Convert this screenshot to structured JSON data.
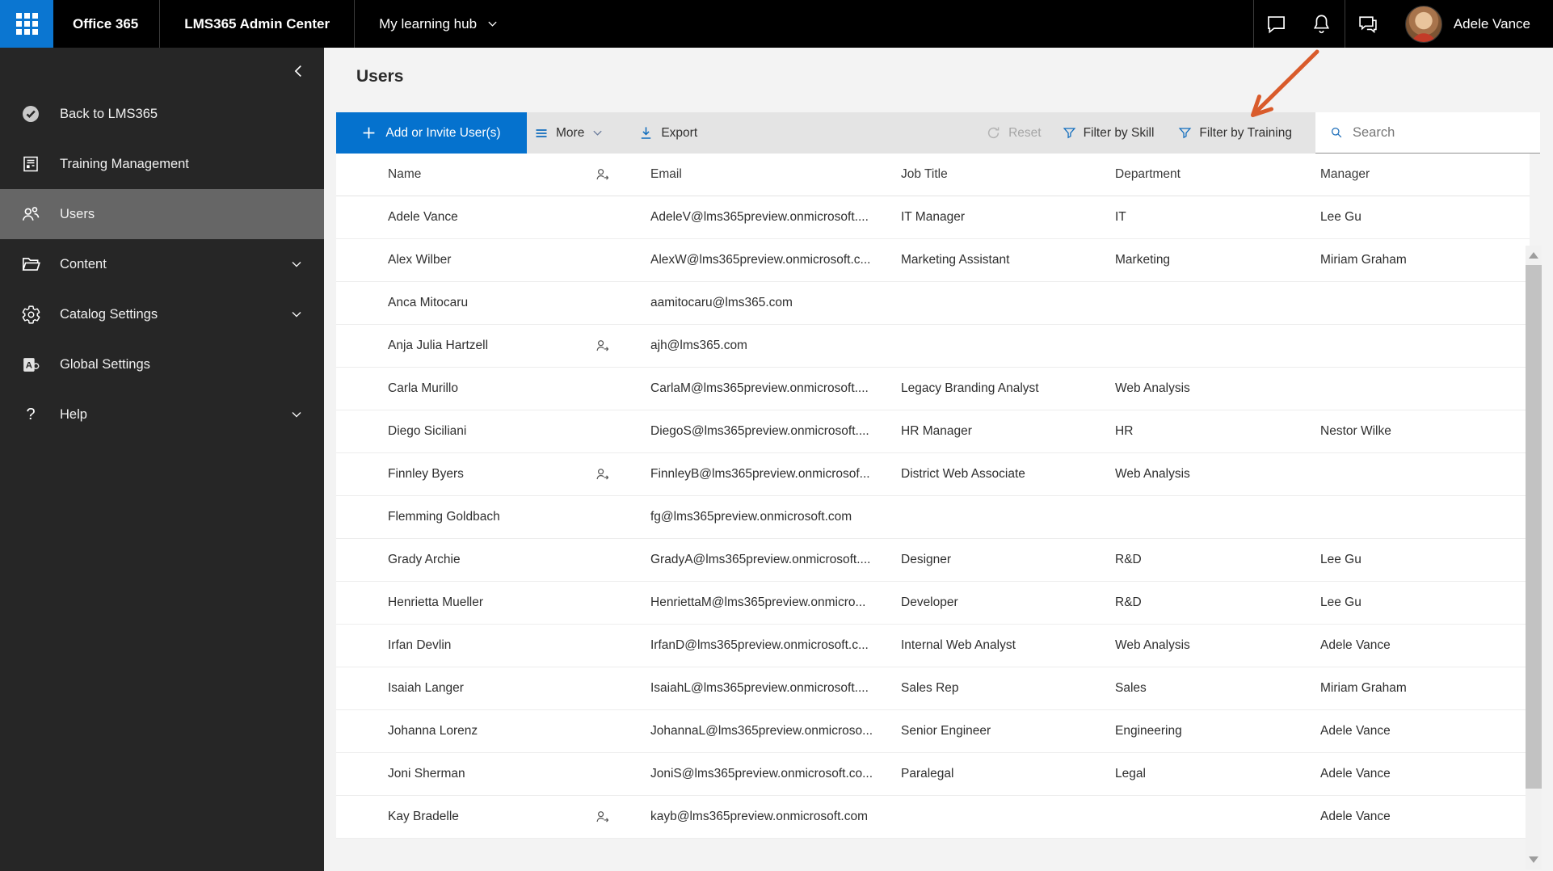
{
  "topbar": {
    "brand": "Office 365",
    "admin_center": "LMS365 Admin Center",
    "learning_hub": "My learning hub",
    "user_name": "Adele Vance"
  },
  "sidebar": {
    "items": [
      {
        "label": "Back to LMS365",
        "icon": "lms365-logo-icon",
        "chevron": false,
        "selected": false
      },
      {
        "label": "Training Management",
        "icon": "training-document-icon",
        "chevron": false,
        "selected": false
      },
      {
        "label": "Users",
        "icon": "people-icon",
        "chevron": false,
        "selected": true
      },
      {
        "label": "Content",
        "icon": "folder-icon",
        "chevron": true,
        "selected": false
      },
      {
        "label": "Catalog Settings",
        "icon": "gear-icon",
        "chevron": true,
        "selected": false
      },
      {
        "label": "Global Settings",
        "icon": "admin-app-icon",
        "chevron": false,
        "selected": false
      },
      {
        "label": "Help",
        "icon": "question-icon",
        "chevron": true,
        "selected": false
      }
    ]
  },
  "page": {
    "title": "Users"
  },
  "toolbar": {
    "add_button": "Add or Invite User(s)",
    "more": "More",
    "export": "Export",
    "reset": "Reset",
    "filter_skill": "Filter by Skill",
    "filter_training": "Filter by Training",
    "search_placeholder": "Search"
  },
  "table": {
    "headers": [
      "Name",
      "Email",
      "Job Title",
      "Department",
      "Manager"
    ],
    "rows": [
      {
        "name": "Adele Vance",
        "invited": false,
        "email": "AdeleV@lms365preview.onmicrosoft....",
        "job_title": "IT Manager",
        "department": "IT",
        "manager": "Lee Gu"
      },
      {
        "name": "Alex Wilber",
        "invited": false,
        "email": "AlexW@lms365preview.onmicrosoft.c...",
        "job_title": "Marketing Assistant",
        "department": "Marketing",
        "manager": "Miriam Graham"
      },
      {
        "name": "Anca Mitocaru",
        "invited": false,
        "email": "aamitocaru@lms365.com",
        "job_title": "",
        "department": "",
        "manager": ""
      },
      {
        "name": "Anja Julia Hartzell",
        "invited": true,
        "email": "ajh@lms365.com",
        "job_title": "",
        "department": "",
        "manager": ""
      },
      {
        "name": "Carla Murillo",
        "invited": false,
        "email": "CarlaM@lms365preview.onmicrosoft....",
        "job_title": "Legacy Branding Analyst",
        "department": "Web Analysis",
        "manager": ""
      },
      {
        "name": "Diego Siciliani",
        "invited": false,
        "email": "DiegoS@lms365preview.onmicrosoft....",
        "job_title": "HR Manager",
        "department": "HR",
        "manager": "Nestor Wilke"
      },
      {
        "name": "Finnley Byers",
        "invited": true,
        "email": "FinnleyB@lms365preview.onmicrosof...",
        "job_title": "District Web Associate",
        "department": "Web Analysis",
        "manager": ""
      },
      {
        "name": "Flemming Goldbach",
        "invited": false,
        "email": "fg@lms365preview.onmicrosoft.com",
        "job_title": "",
        "department": "",
        "manager": ""
      },
      {
        "name": "Grady Archie",
        "invited": false,
        "email": "GradyA@lms365preview.onmicrosoft....",
        "job_title": "Designer",
        "department": "R&D",
        "manager": "Lee Gu"
      },
      {
        "name": "Henrietta Mueller",
        "invited": false,
        "email": "HenriettaM@lms365preview.onmicro...",
        "job_title": "Developer",
        "department": "R&D",
        "manager": "Lee Gu"
      },
      {
        "name": "Irfan Devlin",
        "invited": false,
        "email": "IrfanD@lms365preview.onmicrosoft.c...",
        "job_title": "Internal Web Analyst",
        "department": "Web Analysis",
        "manager": "Adele Vance"
      },
      {
        "name": "Isaiah Langer",
        "invited": false,
        "email": "IsaiahL@lms365preview.onmicrosoft....",
        "job_title": "Sales Rep",
        "department": "Sales",
        "manager": "Miriam Graham"
      },
      {
        "name": "Johanna Lorenz",
        "invited": false,
        "email": "JohannaL@lms365preview.onmicroso...",
        "job_title": "Senior Engineer",
        "department": "Engineering",
        "manager": "Adele Vance"
      },
      {
        "name": "Joni Sherman",
        "invited": false,
        "email": "JoniS@lms365preview.onmicrosoft.co...",
        "job_title": "Paralegal",
        "department": "Legal",
        "manager": "Adele Vance"
      },
      {
        "name": "Kay Bradelle",
        "invited": true,
        "email": "kayb@lms365preview.onmicrosoft.com",
        "job_title": "",
        "department": "",
        "manager": "Adele Vance"
      }
    ]
  },
  "annotation": {
    "type": "arrow",
    "points_at": "Filter by Training",
    "color": "#d95b2b"
  },
  "colors": {
    "accent_blue": "#0572ce",
    "icon_blue": "#0f6cbd",
    "topbar_bg": "#000000",
    "sidebar_bg": "#262626",
    "sidebar_selected": "#666666",
    "toolbar_bg": "#e4e4e4",
    "page_bg": "#f3f3f3",
    "disabled_gray": "#a6a6a6",
    "annotation_orange": "#d95b2b"
  }
}
